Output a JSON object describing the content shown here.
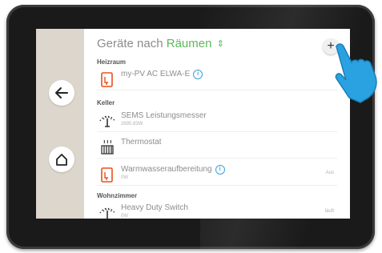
{
  "header": {
    "title_prefix": "Geräte nach",
    "title_highlight": "Räumen",
    "sort_icon": "⇕",
    "add_label": "+"
  },
  "sections": [
    {
      "label": "Heizraum",
      "rows": [
        {
          "name": "my-PV AC ELWA-E",
          "icon": "heater-plug-icon",
          "info": "i",
          "sub": "",
          "value": ""
        }
      ]
    },
    {
      "label": "Keller",
      "rows": [
        {
          "name": "SEMS Leistungsmesser",
          "icon": "meter-icon",
          "info": "",
          "sub": "2695.83W",
          "value": ""
        },
        {
          "name": "Thermostat",
          "icon": "radiator-icon",
          "info": "",
          "sub": "",
          "value": ""
        },
        {
          "name": "Warmwasseraufbereitung",
          "icon": "heater-plug-icon",
          "info": "i",
          "sub": "0W",
          "value": "Aus"
        }
      ]
    },
    {
      "label": "Wohnzimmer",
      "rows": [
        {
          "name": "Heavy Duty Switch",
          "icon": "switch-icon",
          "info": "",
          "sub": "0W",
          "value": "läuft"
        }
      ]
    }
  ],
  "colors": {
    "accent_green": "#5cb85c",
    "info_blue": "#3aa0e0",
    "sidebar": "#dcd6cd",
    "device_icon_orange": "#e8501a"
  }
}
